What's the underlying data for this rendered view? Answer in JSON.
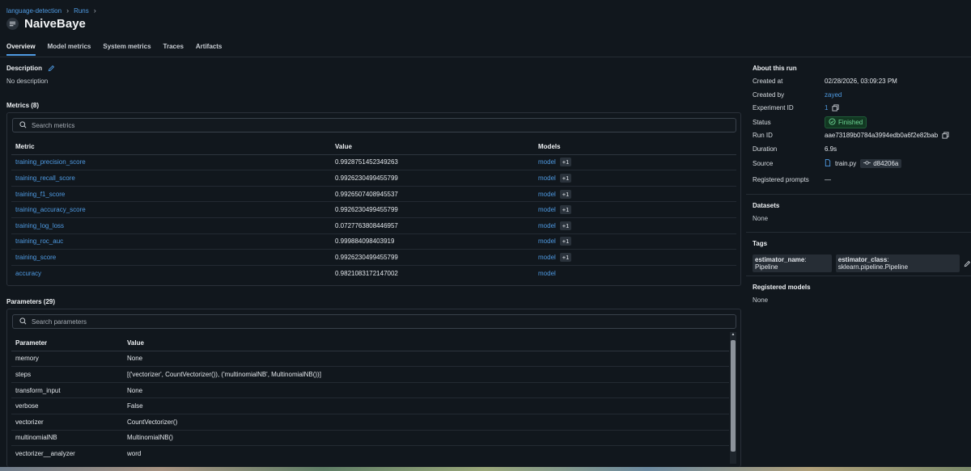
{
  "breadcrumb": {
    "experiment": "language-detection",
    "runs": "Runs"
  },
  "header": {
    "title": "NaiveBaye"
  },
  "tabs": [
    {
      "label": "Overview"
    },
    {
      "label": "Model metrics"
    },
    {
      "label": "System metrics"
    },
    {
      "label": "Traces"
    },
    {
      "label": "Artifacts"
    }
  ],
  "description": {
    "title": "Description",
    "text": "No description"
  },
  "metrics": {
    "title": "Metrics (8)",
    "search_placeholder": "Search metrics",
    "headers": {
      "metric": "Metric",
      "value": "Value",
      "models": "Models"
    },
    "rows": [
      {
        "metric": "training_precision_score",
        "value": "0.9928751452349263",
        "model": "model",
        "extra": "+1"
      },
      {
        "metric": "training_recall_score",
        "value": "0.9926230499455799",
        "model": "model",
        "extra": "+1"
      },
      {
        "metric": "training_f1_score",
        "value": "0.9926507408945537",
        "model": "model",
        "extra": "+1"
      },
      {
        "metric": "training_accuracy_score",
        "value": "0.9926230499455799",
        "model": "model",
        "extra": "+1"
      },
      {
        "metric": "training_log_loss",
        "value": "0.0727763808446957",
        "model": "model",
        "extra": "+1"
      },
      {
        "metric": "training_roc_auc",
        "value": "0.999884098403919",
        "model": "model",
        "extra": "+1"
      },
      {
        "metric": "training_score",
        "value": "0.9926230499455799",
        "model": "model",
        "extra": "+1"
      },
      {
        "metric": "accuracy",
        "value": "0.9821083172147002",
        "model": "model",
        "extra": ""
      }
    ]
  },
  "parameters": {
    "title": "Parameters (29)",
    "search_placeholder": "Search parameters",
    "headers": {
      "parameter": "Parameter",
      "value": "Value"
    },
    "rows": [
      {
        "name": "memory",
        "value": "None"
      },
      {
        "name": "steps",
        "value": "[('vectorizer', CountVectorizer()), ('multinomialNB', MultinomialNB())]"
      },
      {
        "name": "transform_input",
        "value": "None"
      },
      {
        "name": "verbose",
        "value": "False"
      },
      {
        "name": "vectorizer",
        "value": "CountVectorizer()"
      },
      {
        "name": "multinomialNB",
        "value": "MultinomialNB()"
      },
      {
        "name": "vectorizer__analyzer",
        "value": "word"
      }
    ]
  },
  "about": {
    "title": "About this run",
    "created_at_label": "Created at",
    "created_at": "02/28/2026, 03:09:23 PM",
    "created_by_label": "Created by",
    "created_by": "zayed",
    "experiment_id_label": "Experiment ID",
    "experiment_id": "1",
    "status_label": "Status",
    "status": "Finished",
    "run_id_label": "Run ID",
    "run_id": "aae73189b0784a3994edb0a6f2e82bab",
    "duration_label": "Duration",
    "duration": "6.9s",
    "source_label": "Source",
    "source_file": "train.py",
    "source_commit": "d84206a",
    "registered_prompts_label": "Registered prompts",
    "registered_prompts": "—"
  },
  "datasets": {
    "title": "Datasets",
    "value": "None"
  },
  "tags": {
    "title": "Tags",
    "items": [
      {
        "key": "estimator_name",
        "value": "Pipeline"
      },
      {
        "key": "estimator_class",
        "value": "sklearn.pipeline.Pipeline"
      }
    ]
  },
  "registered_models": {
    "title": "Registered models",
    "value": "None"
  },
  "colors": {
    "accent": "#4f9be3",
    "background": "#11171d",
    "status_success": "#6fd796"
  }
}
